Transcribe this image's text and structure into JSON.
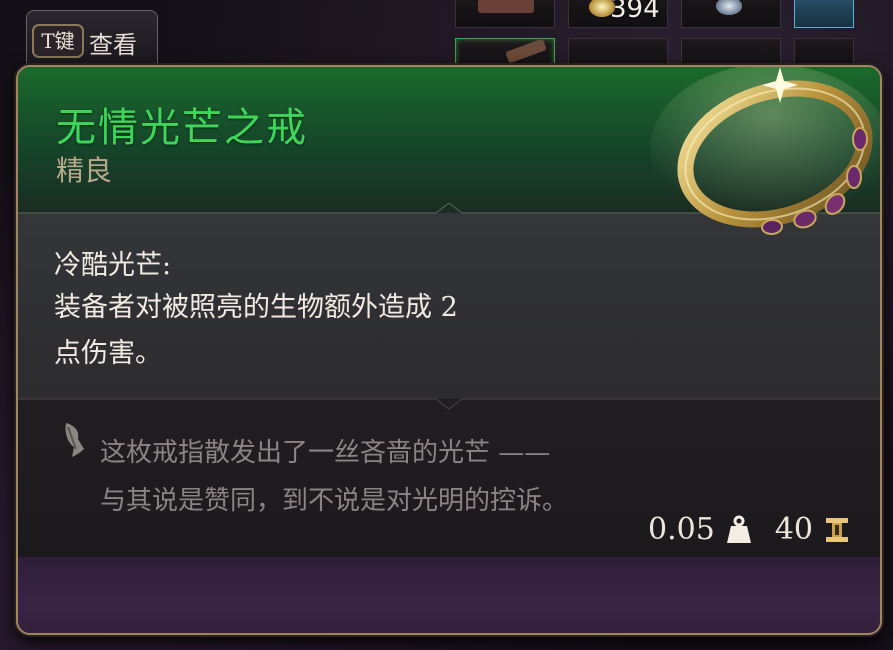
{
  "hotkey": {
    "key": "T键",
    "label": "查看"
  },
  "inventory": {
    "stack_count": "394"
  },
  "item": {
    "name": "无情光芒之戒",
    "rarity": "精良",
    "rarity_color": "#3fd45a",
    "icon": "ring-icon",
    "effect": {
      "title": "冷酷光芒:",
      "description_line1": "装备者对被照亮的生物额外造成 2",
      "description_line2": "点伤害。"
    },
    "flavor": {
      "icon": "quill-icon",
      "line1": "这枚戒指散发出了一丝吝啬的光芒 ——",
      "line2": "与其说是赞同，到不说是对光明的控诉。"
    },
    "weight": "0.05",
    "weight_icon": "weight-icon",
    "value": "40",
    "value_icon": "gold-coin-icon"
  }
}
